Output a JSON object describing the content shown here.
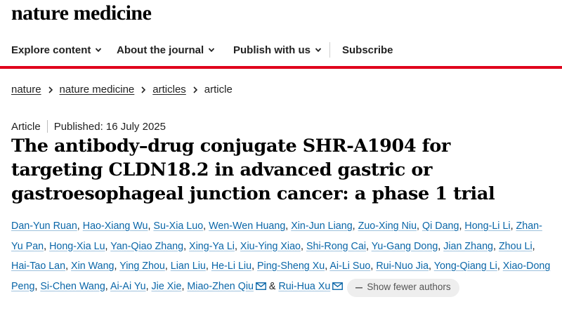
{
  "site": {
    "logo": "nature medicine"
  },
  "nav": {
    "items": [
      {
        "label": "Explore content",
        "has_menu": true
      },
      {
        "label": "About the journal",
        "has_menu": true
      },
      {
        "label": "Publish with us",
        "has_menu": true
      }
    ],
    "subscribe": "Subscribe"
  },
  "breadcrumb": [
    "nature",
    "nature medicine",
    "articles",
    "article"
  ],
  "article": {
    "type": "Article",
    "published": "Published: 16 July 2025",
    "title": "The antibody–drug conjugate SHR-A1904 for targeting CLDN18.2 in advanced gastric or gastroesophageal junction cancer: a phase 1 trial",
    "authors": [
      "Dan-Yun Ruan",
      "Hao-Xiang Wu",
      "Su-Xia Luo",
      "Wen-Wen Huang",
      "Xin-Jun Liang",
      "Zuo-Xing Niu",
      "Qi Dang",
      "Hong-Li Li",
      "Zhan-Yu Pan",
      "Hong-Xia Lu",
      "Yan-Qiao Zhang",
      "Xing-Ya Li",
      "Xiu-Ying Xiao",
      "Shi-Rong Cai",
      "Yu-Gang Dong",
      "Jian Zhang",
      "Zhou Li",
      "Hai-Tao Lan",
      "Xin Wang",
      "Ying Zhou",
      "Lian Liu",
      "He-Li Liu",
      "Ping-Sheng Xu",
      "Ai-Li Suo",
      "Rui-Nuo Jia",
      "Yong-Qiang Li",
      "Xiao-Dong Peng",
      "Si-Chen Wang",
      "Ai-Ai Yu",
      "Jie Xie",
      "Miao-Zhen Qiu"
    ],
    "last_author": "Rui-Hua Xu",
    "corresponding": [
      "Miao-Zhen Qiu",
      "Rui-Hua Xu"
    ],
    "ampersand": "&",
    "show_fewer": "Show fewer authors"
  },
  "colors": {
    "accent_red": "#e0001b",
    "link_blue": "#0a66a8"
  }
}
